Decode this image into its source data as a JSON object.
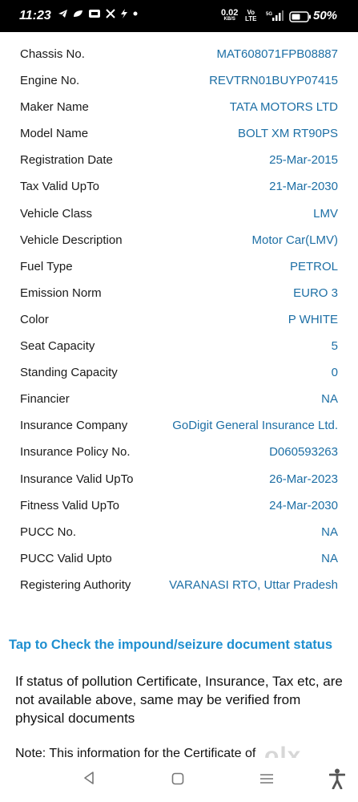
{
  "status_bar": {
    "time": "11:23",
    "speed_value": "0.02",
    "speed_unit": "KB/S",
    "network_top": "Vo",
    "network_bottom": "LTE",
    "network_gen": "5G",
    "battery": "50%",
    "left_icons": [
      "telegram-icon",
      "leaf-icon",
      "bank-icon",
      "x-icon",
      "bolt-icon",
      "dot-icon"
    ]
  },
  "details": [
    {
      "label": "Chassis No.",
      "value": "MAT608071FPB08887"
    },
    {
      "label": "Engine No.",
      "value": "REVTRN01BUYP07415"
    },
    {
      "label": "Maker Name",
      "value": "TATA MOTORS LTD"
    },
    {
      "label": "Model Name",
      "value": "BOLT XM RT90PS"
    },
    {
      "label": "Registration Date",
      "value": "25-Mar-2015"
    },
    {
      "label": "Tax Valid UpTo",
      "value": "21-Mar-2030"
    },
    {
      "label": "Vehicle Class",
      "value": "LMV"
    },
    {
      "label": "Vehicle Description",
      "value": "Motor Car(LMV)"
    },
    {
      "label": "Fuel Type",
      "value": "PETROL"
    },
    {
      "label": "Emission Norm",
      "value": "EURO 3"
    },
    {
      "label": "Color",
      "value": "P WHITE"
    },
    {
      "label": "Seat Capacity",
      "value": "5"
    },
    {
      "label": "Standing Capacity",
      "value": "0"
    },
    {
      "label": "Financier",
      "value": "NA"
    },
    {
      "label": "Insurance Company",
      "value": "GoDigit General Insurance Ltd."
    },
    {
      "label": "Insurance Policy No.",
      "value": "D060593263"
    },
    {
      "label": "Insurance Valid UpTo",
      "value": "26-Mar-2023"
    },
    {
      "label": "Fitness Valid UpTo",
      "value": "24-Mar-2030"
    },
    {
      "label": "PUCC No.",
      "value": "NA"
    },
    {
      "label": "PUCC Valid Upto",
      "value": "NA"
    },
    {
      "label": "Registering Authority",
      "value": "VARANASI RTO, Uttar Pradesh"
    }
  ],
  "impound_link": "Tap to Check the impound/seizure document status",
  "notice": "If status of pollution Certificate, Insurance, Tax etc, are not available above, same may be verified from physical documents",
  "note": "Note:  This information for the Certificate of",
  "watermark": "olx",
  "colors": {
    "status_bar_bg": "#000000",
    "value_text": "#1d6fa5",
    "link_text": "#1e8fd0",
    "label_text": "#1a1a1a"
  }
}
